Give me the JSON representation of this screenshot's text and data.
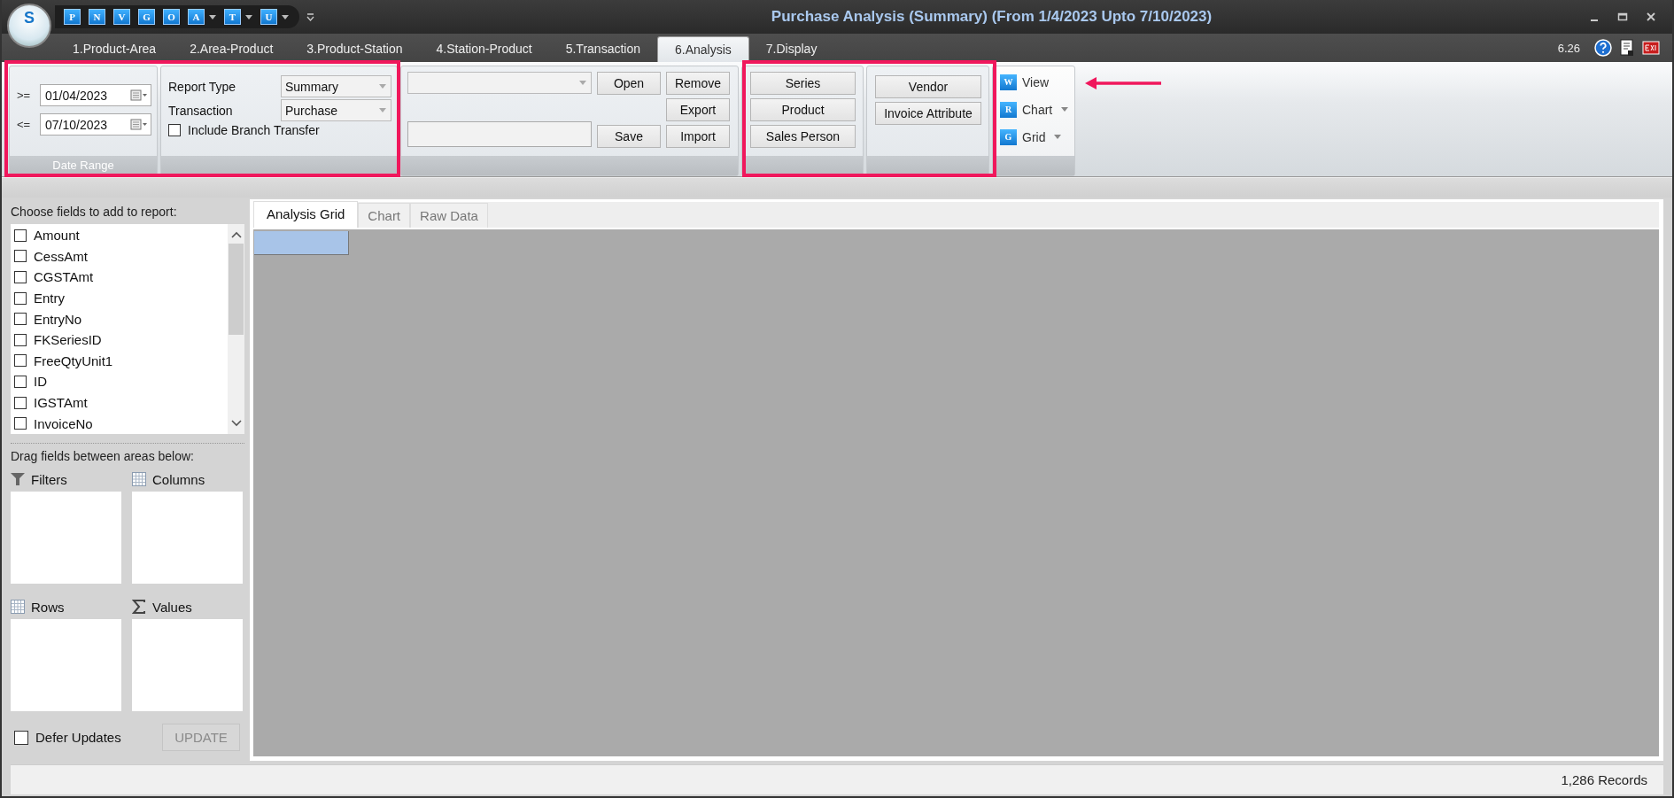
{
  "window": {
    "title": "Purchase Analysis (Summary) (From 1/4/2023 Upto 7/10/2023)",
    "logo": "S"
  },
  "quick_access": [
    {
      "label": "P",
      "has_menu": false
    },
    {
      "label": "N",
      "has_menu": false
    },
    {
      "label": "V",
      "has_menu": false
    },
    {
      "label": "G",
      "has_menu": false
    },
    {
      "label": "O",
      "has_menu": false
    },
    {
      "label": "A",
      "has_menu": true
    },
    {
      "label": "T",
      "has_menu": true
    },
    {
      "label": "U",
      "has_menu": true
    }
  ],
  "tabs": [
    {
      "label": "1.Product-Area",
      "selected": false
    },
    {
      "label": "2.Area-Product",
      "selected": false
    },
    {
      "label": "3.Product-Station",
      "selected": false
    },
    {
      "label": "4.Station-Product",
      "selected": false
    },
    {
      "label": "5.Transaction",
      "selected": false
    },
    {
      "label": "6.Analysis",
      "selected": true
    },
    {
      "label": "7.Display",
      "selected": false
    }
  ],
  "version": "6.26",
  "ribbon": {
    "date_range": {
      "label": "Date Range",
      "from": {
        "operator": ">=",
        "value": "01/04/2023"
      },
      "to": {
        "operator": "<=",
        "value": "07/10/2023"
      }
    },
    "report": {
      "fields": [
        {
          "label": "Report Type",
          "value": "Summary"
        },
        {
          "label": "Transaction",
          "value": "Purchase"
        }
      ],
      "include_branch_transfer": {
        "label": "Include Branch Transfer",
        "checked": false
      }
    },
    "layouts": {
      "open": "Open",
      "remove": "Remove",
      "export": "Export",
      "save": "Save",
      "import": "Import"
    },
    "filter_buttons": [
      "Series",
      "Product",
      "Sales Person"
    ],
    "party_buttons": [
      "Vendor",
      "Invoice Attribute"
    ],
    "view_menu": [
      {
        "label": "View",
        "icon": "W",
        "has_menu": false
      },
      {
        "label": "Chart",
        "icon": "R",
        "has_menu": true
      },
      {
        "label": "Grid",
        "icon": "G",
        "has_menu": true
      }
    ]
  },
  "field_list": {
    "title": "Choose fields to add to report:",
    "fields": [
      {
        "label": "Amount",
        "checked": false
      },
      {
        "label": "CessAmt",
        "checked": false
      },
      {
        "label": "CGSTAmt",
        "checked": false
      },
      {
        "label": "Entry",
        "checked": false
      },
      {
        "label": "EntryNo",
        "checked": false
      },
      {
        "label": "FKSeriesID",
        "checked": false
      },
      {
        "label": "FreeQtyUnit1",
        "checked": false
      },
      {
        "label": "ID",
        "checked": false
      },
      {
        "label": "IGSTAmt",
        "checked": false
      },
      {
        "label": "InvoiceNo",
        "checked": false
      }
    ]
  },
  "drag_hint": "Drag fields between areas below:",
  "areas": [
    {
      "label": "Filters",
      "kind": "filters"
    },
    {
      "label": "Columns",
      "kind": "columns"
    },
    {
      "label": "Rows",
      "kind": "rows"
    },
    {
      "label": "Values",
      "kind": "values"
    }
  ],
  "defer_updates": {
    "label": "Defer Updates",
    "checked": false
  },
  "update_button": {
    "label": "UPDATE",
    "disabled": true
  },
  "view_tabs": [
    {
      "label": "Analysis Grid",
      "selected": true
    },
    {
      "label": "Chart",
      "selected": false
    },
    {
      "label": "Raw Data",
      "selected": false
    }
  ],
  "status_bar": {
    "records": "1,286 Records"
  }
}
